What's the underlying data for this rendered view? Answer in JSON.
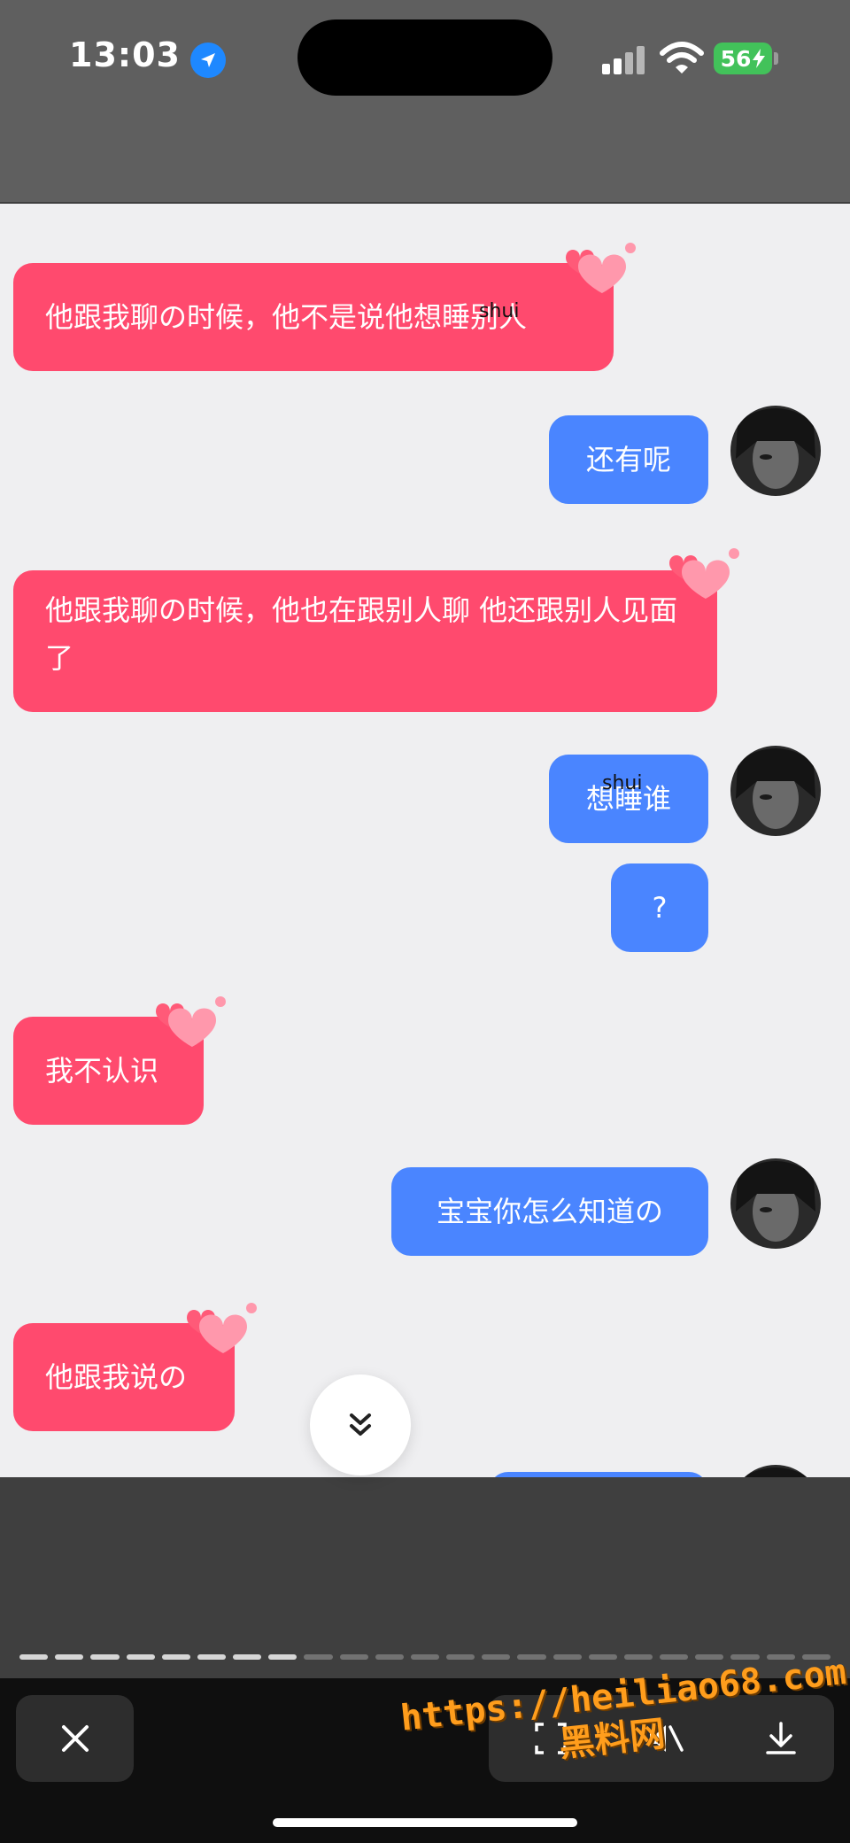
{
  "status_bar": {
    "time": "13:03",
    "battery": "56",
    "icons": [
      "location-arrow-icon",
      "cellular-signal-icon",
      "wifi-icon",
      "battery-charging-icon"
    ]
  },
  "messages": [
    {
      "side": "incoming",
      "text": "他跟我聊の时候，他不是说他想睡别人",
      "overlay": "shui"
    },
    {
      "side": "outgoing",
      "text": "还有呢"
    },
    {
      "side": "incoming",
      "text": "他跟我聊の时候，他也在跟别人聊 他还跟别人见面了"
    },
    {
      "side": "outgoing",
      "text": "想睡谁",
      "overlay": "shui"
    },
    {
      "side": "outgoing",
      "text": "?"
    },
    {
      "side": "incoming",
      "text": "我不认识"
    },
    {
      "side": "outgoing",
      "text": "宝宝你怎么知道の"
    },
    {
      "side": "incoming",
      "text": "他跟我说の"
    }
  ],
  "viewer": {
    "progress_total": 23,
    "progress_done": 8,
    "icons": [
      "scroll-down-icon",
      "close-icon",
      "screenshot-icon",
      "mute-icon",
      "download-icon"
    ]
  },
  "watermark": {
    "line1": "https://heiliao68.com",
    "line2": "黑料网"
  },
  "colors": {
    "incoming_bubble": "#ff4a6e",
    "outgoing_bubble": "#4a85ff",
    "chat_background": "#efeff1"
  }
}
